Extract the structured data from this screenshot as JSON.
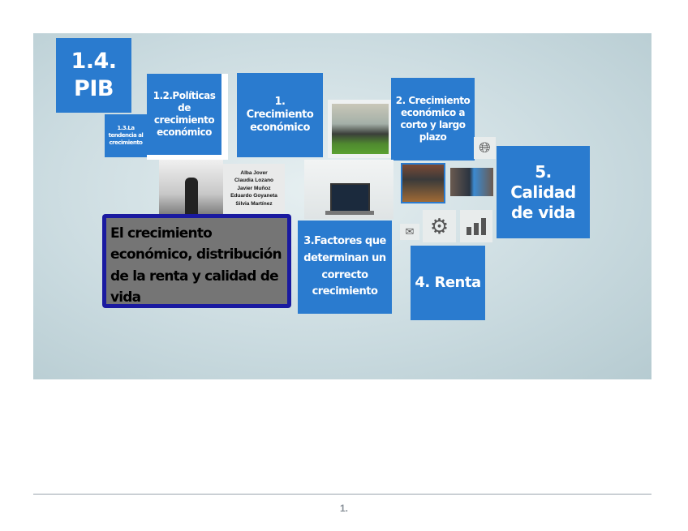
{
  "slide": {
    "tile_pib": "1.4. PIB",
    "tile_tendencia": "1.3.La tendencia al crecimiento",
    "tile_politicas": "1.2.Políticas de crecimiento económico",
    "tile_crecimiento": "1. Crecimiento económico",
    "tile_corto_largo": "2. Crecimiento económico a corto y largo plazo",
    "tile_calidad": "5. Calidad de vida",
    "tile_factores": "3.Factores que determinan un correcto crecimiento",
    "tile_renta": "4. Renta",
    "title": "El crecimiento económico, distribución de la renta y calidad de vida",
    "authors": [
      "Alba Jover",
      "Claudia Lozano",
      "Javier Muñoz",
      "Eduardo Goyaneta",
      "Silvia Martínez"
    ]
  },
  "footer": {
    "page_number": "1."
  },
  "colors": {
    "tile_blue": "#2a7bcf",
    "title_border": "#1a1aa0"
  }
}
